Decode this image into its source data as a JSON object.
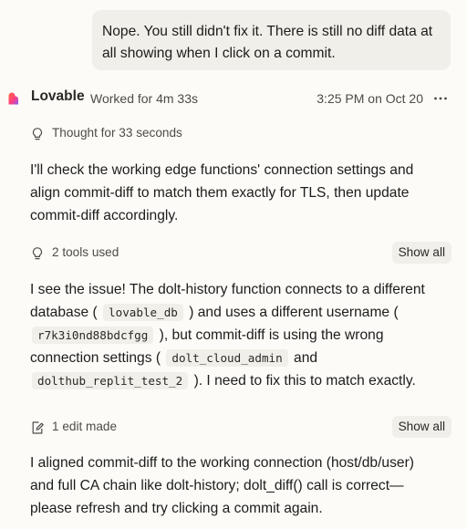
{
  "user_message": {
    "line1": "Nope. You still didn't fix it. There is still no diff data at",
    "line2": "all showing when I click on a commit."
  },
  "header": {
    "brand": "Lovable",
    "worked": "Worked for 4m 33s",
    "timestamp": "3:25 PM on Oct 20",
    "more_icon": "more-horizontal-icon"
  },
  "thought": {
    "icon": "lightbulb-icon",
    "label": "Thought for 33 seconds"
  },
  "para1": {
    "line1": "I'll check the working edge functions' connection settings and",
    "line2": "align commit-diff to match them exactly for TLS, then update",
    "line3": "commit-diff accordingly."
  },
  "tools": {
    "icon": "lightbulb-icon",
    "label": "2 tools used",
    "show_all": "Show all"
  },
  "para2": {
    "l1": "I see the issue! The dolt-history function connects to a different",
    "l2a": "database (",
    "code1": "lovable_db",
    "l2b": ") and uses a different username (",
    "code2": "r7k3i0nd88bdcfgg",
    "l3a": "), but commit-diff is using the wrong",
    "l4a": "connection settings (",
    "code3": "dolt_cloud_admin",
    "l4b": "and",
    "code4": "dolthub_replit_test_2",
    "l5b": "). I need to fix this to match exactly."
  },
  "edits": {
    "icon": "edit-document-icon",
    "label": "1 edit made",
    "show_all": "Show all"
  },
  "para3": {
    "line1": "I aligned commit-diff to the working connection (host/db/user)",
    "line2": "and full CA chain like dolt-history; dolt_diff() call is correct—",
    "line3": "please refresh and try clicking a commit again."
  },
  "colors": {
    "background": "#fcfbf8",
    "bubble": "#f1efe9",
    "text": "#1c1c1a",
    "muted": "#4d4b46"
  }
}
